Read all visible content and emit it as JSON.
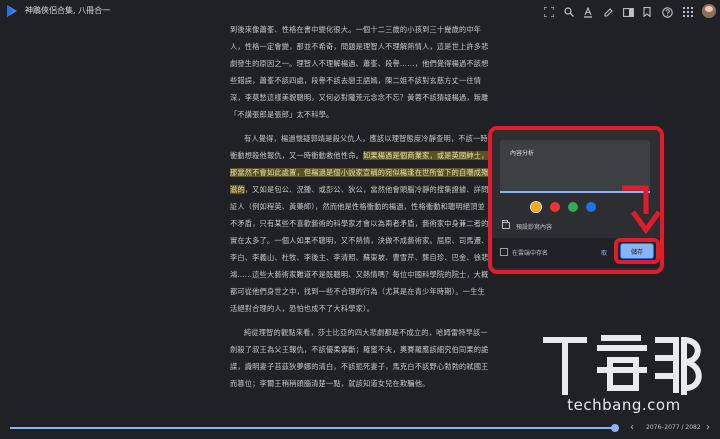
{
  "header": {
    "book_title": "神鵰俠侶合集, 八冊合一"
  },
  "toolbar": {
    "icons": [
      "fullscreen-icon",
      "search-icon",
      "text-format-icon",
      "highlight-icon",
      "two-page-icon",
      "bookmark-icon",
      "help-icon",
      "apps-icon",
      "avatar"
    ]
  },
  "content": {
    "paragraphs": [
      {
        "indent": false,
        "text": "到後來像蕭峯、性格在書中變化很大。一個十二三歲的小孩到三十幾歲的中年人，性格一定會變，那並不希奇，問題是理智人不理解熱情人，這是世上許多悲劇發生的原因之一。理智人不理解楊過、蕭峯、段譽……，他們覺得楊過不該想些錯誤，蕭峯不該四處，段譽不該去戀王語嫣，陳二姐不該對玄慈方丈一往情深，李莫愁這樣美貌聰明，又何必對隴荒元念念不忘？黃蓉不該猜疑楊過，叛離「不講張郎是張郎」太不科學。"
      },
      {
        "indent": true,
        "before": "有人覺得，楊過懷疑郭靖是殺父仇人，應該以理智態度冷靜查明，不該一時衝動想殺他報仇，又一時衝動救他性命。",
        "highlight": "如果楊過是個商業家，或是英國紳士，那當然不會如此處置，但楊過是個小說家宣稱的宛似楊逢在世所留下的自嘲成殤滋的",
        "after": "，又如是包公、況鍾、或彭公、狄公，當然他會頭腦冷靜的搜集證據、詳問証人（例如程英、黃藥師），然而他是性格衝動的楊過，性格衝動和聰明絕頂並不矛盾，只有某些不喜歡藝術的科學家才會以為兩者矛盾，藝術家中身兼二者的實在太多了。一個人如果不聰明，又不熱情，決做不成藝術家。屈原、司馬遷、李白、李義山、杜牧、李後主、李清照、蘇東坡、曹雪芹、龔自珍、巴金、徐悲鴻……這些大藝術家難道不是既聰明、又熱情嗎？每位中國科學院的院士，大概都可從他們身世之中，找到一些不合理的行為（尤其是在青少年時期）。一生生活絕對合理的人，恐怕也成不了大科學家）。"
      },
      {
        "indent": true,
        "text": "純從理智的觀點來看，莎士比亞的四大悲劇都是不成立的，哈姆雷特早該一劍殺了叔王為父王報仇，不該優柔寡斷；羅蜜不夫，奧賽羅應該細究伯同果的詭謀，識明妻子苔茲狄夢娜的清白，不該扼死妻子，馬克白不該野心勃勃的弒國王而篡位；李爾王稍稍頭腦清楚一點，就該知道女兒在欺騙他。"
      }
    ]
  },
  "note_dialog": {
    "field_label": "內容分析",
    "colors": [
      "#f9ab00",
      "#e53935",
      "#34a853",
      "#1a73e8"
    ],
    "document_name": "預設鈔寫內容",
    "footer_text": "在雲端中存名",
    "cancel_label": "取",
    "save_label": "儲存",
    "annotation_color": "#e21c2a"
  },
  "footer": {
    "progress_fraction": 0.995,
    "page_label": "2076–2077 / 2082",
    "prev_icon": "chevron-left-icon",
    "next_icon": "chevron-right-icon"
  },
  "watermark": {
    "text": "techbang.com",
    "logo": "tekbang-logo"
  }
}
